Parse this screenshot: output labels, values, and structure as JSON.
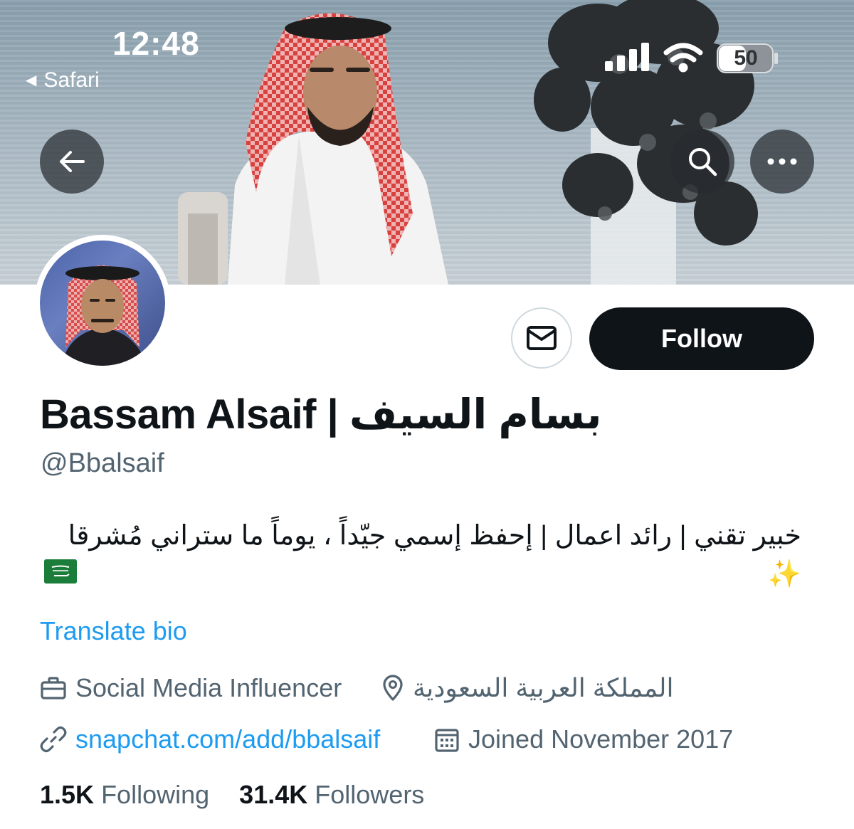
{
  "status_bar": {
    "time": "12:48",
    "back_app": "Safari",
    "battery": "50"
  },
  "profile": {
    "display_name": "Bassam Alsaif | بسام السيف",
    "handle": "@Bbalsaif",
    "bio": "خبير تقني | رائد اعمال | إحفظ إسمي جيّداً ، يوماً ما ستراني مُشرقا ✨",
    "translate_label": "Translate bio",
    "category": "Social Media Influencer",
    "location": "المملكة العربية السعودية",
    "website": "snapchat.com/add/bbalsaif",
    "joined": "Joined November 2017",
    "following_count": "1.5K",
    "following_label": "Following",
    "followers_count": "31.4K",
    "followers_label": "Followers"
  },
  "actions": {
    "follow_label": "Follow"
  },
  "colors": {
    "link": "#1d9bf0",
    "secondary_text": "#536471",
    "primary_text": "#0f1419"
  },
  "icons": [
    "back-arrow-icon",
    "search-icon",
    "more-icon",
    "mail-icon",
    "briefcase-icon",
    "location-pin-icon",
    "link-icon",
    "calendar-icon",
    "saudi-flag-icon",
    "signal-icon",
    "wifi-icon",
    "battery-icon"
  ]
}
